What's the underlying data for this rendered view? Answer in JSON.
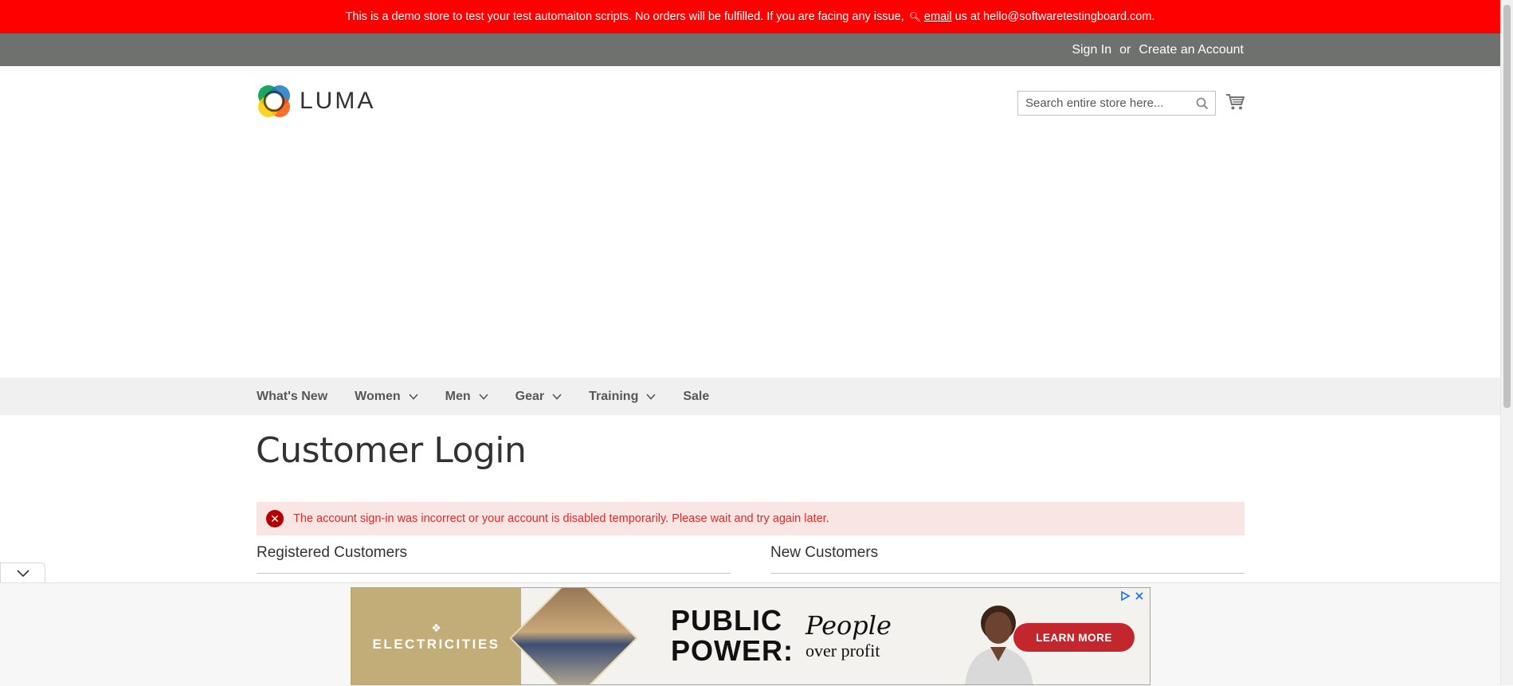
{
  "demo_notice": {
    "text_before": "This is a demo store to test your test automaiton scripts. No orders will be fulfilled. If you are facing any issue,",
    "key_icon": "key-icon",
    "email_link": "email",
    "text_after": "us at hello@softwaretestingboard.com."
  },
  "header": {
    "sign_in": "Sign In",
    "or": "or",
    "create_account": "Create an Account"
  },
  "logo": {
    "text": "LUMA"
  },
  "search": {
    "placeholder": "Search entire store here..."
  },
  "nav": {
    "items": [
      {
        "label": "What's New",
        "has_dropdown": false
      },
      {
        "label": "Women",
        "has_dropdown": true
      },
      {
        "label": "Men",
        "has_dropdown": true
      },
      {
        "label": "Gear",
        "has_dropdown": true
      },
      {
        "label": "Training",
        "has_dropdown": true
      },
      {
        "label": "Sale",
        "has_dropdown": false
      }
    ]
  },
  "page": {
    "title": "Customer Login",
    "error_message": "The account sign-in was incorrect or your account is disabled temporarily. Please wait and try again later.",
    "registered_title": "Registered Customers",
    "new_title": "New Customers"
  },
  "ad": {
    "brand": "ELECTRICITIES",
    "headline_line1": "PUBLIC",
    "headline_line2": "POWER:",
    "tagline_1": "People",
    "tagline_2": "over profit",
    "cta": "LEARN MORE"
  },
  "colors": {
    "demo_bar": "#ff0000",
    "header_panel": "#6e716e",
    "nav_bg": "#f0f0f0",
    "error_bg": "#fae5e5",
    "error_text": "#e02b27",
    "ad_cta": "#c4262e",
    "ad_brand_bg": "#c2ad79"
  }
}
